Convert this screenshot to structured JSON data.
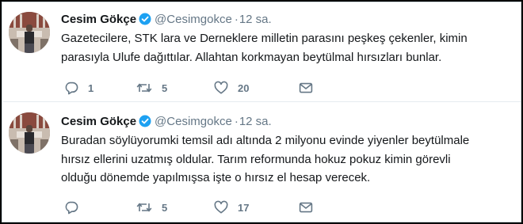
{
  "colors": {
    "text": "#14171a",
    "secondary": "#657786",
    "verified": "#1da1f2",
    "border": "#e6ecf0"
  },
  "tweets": [
    {
      "name": "Cesim Gökçe",
      "handle": "@Cesimgokce",
      "separator": "·",
      "time": "12 sa.",
      "lines": [
        "Gazetecilere, STK lara ve Derneklere milletin parasını peşkeş çekenler, kimin",
        "parasıyla Ulufe dağıttılar. Allahtan korkmayan beytülmal hırsızları bunlar."
      ],
      "reply_count": "1",
      "retweet_count": "5",
      "like_count": "20",
      "icons": [
        "reply-icon",
        "retweet-icon",
        "heart-icon",
        "direct-message-icon"
      ]
    },
    {
      "name": "Cesim Gökçe",
      "handle": "@Cesimgokce",
      "separator": "·",
      "time": "12 sa.",
      "lines": [
        "Buradan söylüyorumki  temsil adı altında 2 milyonu evinde yiyenler beytülmale",
        "hırsız ellerini uzatmış oldular. Tarım reformunda hokuz pokuz kimin görevli",
        "olduğu dönemde yapılmışsa işte o hırsız el hesap verecek."
      ],
      "reply_count": "",
      "retweet_count": "5",
      "like_count": "17",
      "icons": [
        "reply-icon",
        "retweet-icon",
        "heart-icon",
        "direct-message-icon"
      ]
    }
  ]
}
